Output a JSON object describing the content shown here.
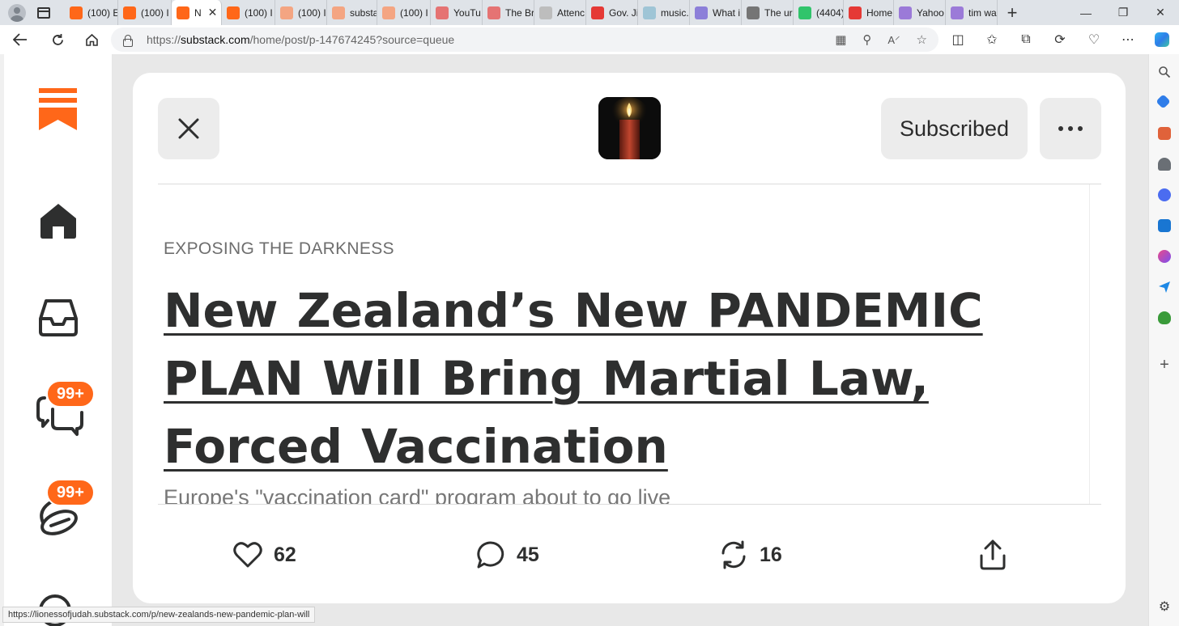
{
  "browser": {
    "tabs": [
      {
        "label": "(100) E",
        "favicon_color": "#ff6719",
        "active": false
      },
      {
        "label": "(100) I",
        "favicon_color": "#ff6719",
        "active": false
      },
      {
        "label": "N",
        "favicon_color": "#ff6719",
        "active": true
      },
      {
        "label": "(100) I",
        "favicon_color": "#ff6719",
        "active": false
      },
      {
        "label": "(100) I",
        "favicon_color": "#f4a582",
        "active": false
      },
      {
        "label": "substa",
        "favicon_color": "#f4a582",
        "active": false
      },
      {
        "label": "(100) I",
        "favicon_color": "#f4a582",
        "active": false
      },
      {
        "label": "YouTu",
        "favicon_color": "#e57373",
        "active": false
      },
      {
        "label": "The Br",
        "favicon_color": "#e57373",
        "active": false
      },
      {
        "label": "Attenc",
        "favicon_color": "#bdbdbd",
        "active": false
      },
      {
        "label": "Gov. Ji",
        "favicon_color": "#e53935",
        "active": false
      },
      {
        "label": "music.",
        "favicon_color": "#9fc5d6",
        "active": false
      },
      {
        "label": "What i",
        "favicon_color": "#8c7fd9",
        "active": false
      },
      {
        "label": "The ur",
        "favicon_color": "#757575",
        "active": false
      },
      {
        "label": "(4404)",
        "favicon_color": "#31c46b",
        "active": false
      },
      {
        "label": "Home",
        "favicon_color": "#e53935",
        "active": false
      },
      {
        "label": "Yahoo",
        "favicon_color": "#9b7ad8",
        "active": false
      },
      {
        "label": "tim wa",
        "favicon_color": "#9b7ad8",
        "active": false
      }
    ],
    "url_prefix": "https://",
    "url_host": "substack.com",
    "url_path": "/home/post/p-147674245?source=queue",
    "status_url": "https://lionessofjudah.substack.com/p/new-zealands-new-pandemic-plan-will"
  },
  "nav": {
    "chat_badge": "99+",
    "activity_badge": "99+"
  },
  "post": {
    "subscribed_label": "Subscribed",
    "section": "EXPOSING THE DARKNESS",
    "title": "New Zealand’s New PANDEMIC PLAN Will Bring Martial Law, Forced Vaccination",
    "subtitle": "Europe's \"vaccination card\" program about to go live",
    "likes": "62",
    "comments": "45",
    "restacks": "16"
  },
  "colors": {
    "brand": "#ff6719",
    "text": "#363737"
  }
}
